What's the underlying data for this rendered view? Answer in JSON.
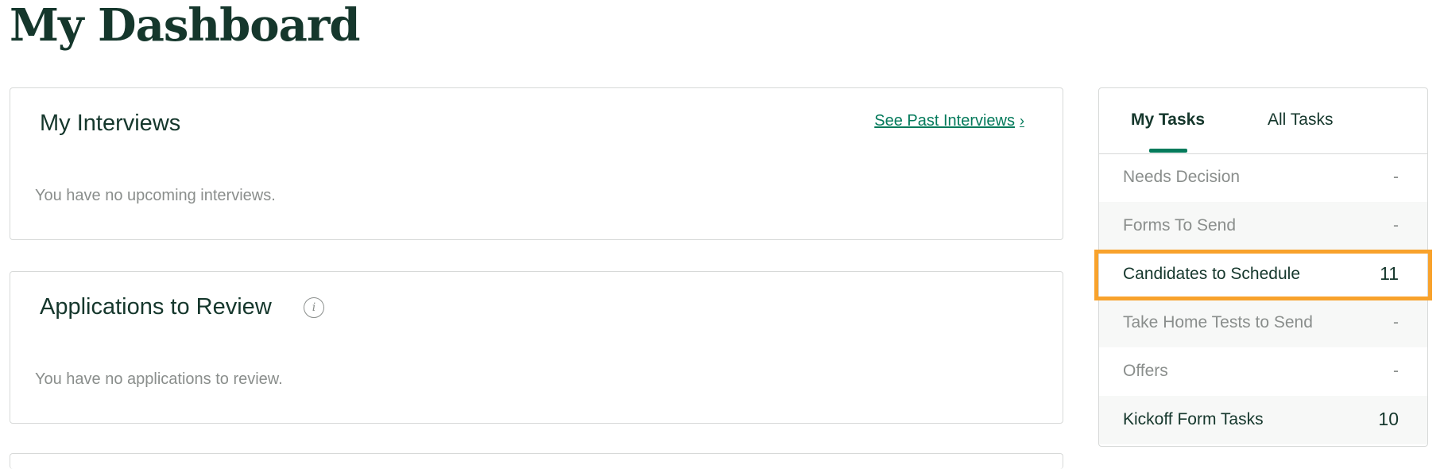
{
  "page": {
    "title": "My Dashboard"
  },
  "interviews": {
    "title": "My Interviews",
    "link_label": "See Past Interviews",
    "empty_text": "You have no upcoming interviews."
  },
  "applications": {
    "title": "Applications to Review",
    "info_icon": "info-icon",
    "empty_text": "You have no applications to review."
  },
  "tasks": {
    "tabs": [
      {
        "label": "My Tasks",
        "selected": true
      },
      {
        "label": "All Tasks",
        "selected": false
      }
    ],
    "rows": [
      {
        "label": "Needs Decision",
        "count": "-"
      },
      {
        "label": "Forms To Send",
        "count": "-"
      },
      {
        "label": "Candidates to Schedule",
        "count": "11",
        "highlighted": true
      },
      {
        "label": "Take Home Tests to Send",
        "count": "-"
      },
      {
        "label": "Offers",
        "count": "-"
      },
      {
        "label": "Kickoff Form Tasks",
        "count": "10"
      }
    ]
  },
  "colors": {
    "brand_green": "#15372c",
    "accent_green": "#047a5b",
    "highlight_orange": "#f8a22c",
    "muted_text": "#8a8e8c"
  }
}
